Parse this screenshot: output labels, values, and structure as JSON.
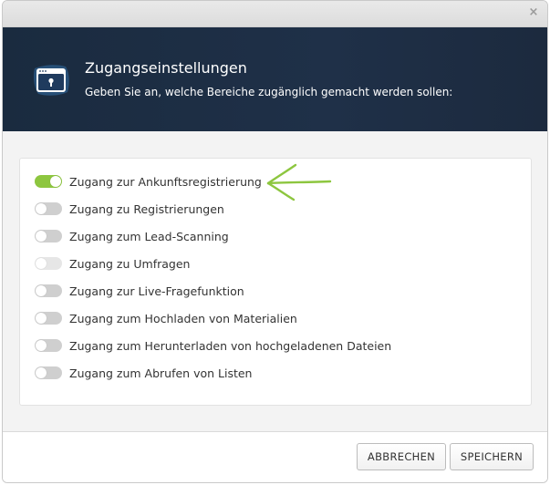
{
  "dialog": {
    "close_glyph": "×"
  },
  "header": {
    "icon": "browser-lock-icon",
    "title": "Zugangseinstellungen",
    "subtitle": "Geben Sie an, welche Bereiche zugänglich gemacht werden sollen:"
  },
  "settings": {
    "items": [
      {
        "label": "Zugang zur Ankunftsregistrierung",
        "state": "on"
      },
      {
        "label": "Zugang zu Registrierungen",
        "state": "off"
      },
      {
        "label": "Zugang zum Lead-Scanning",
        "state": "off"
      },
      {
        "label": "Zugang zu Umfragen",
        "state": "disabled"
      },
      {
        "label": "Zugang zur Live-Fragefunktion",
        "state": "off"
      },
      {
        "label": "Zugang zum Hochladen von Materialien",
        "state": "off"
      },
      {
        "label": "Zugang zum Herunterladen von hochgeladenen Dateien",
        "state": "off"
      },
      {
        "label": "Zugang zum Abrufen von Listen",
        "state": "off"
      }
    ]
  },
  "annotation": {
    "icon": "hand-drawn-arrow-icon",
    "color": "#8dc63f"
  },
  "footer": {
    "cancel_label": "ABBRECHEN",
    "save_label": "SPEICHERN"
  },
  "colors": {
    "header_bg": "#1d2d43",
    "toggle_on": "#8dc63f",
    "toggle_off": "#cfcfcf",
    "toggle_disabled": "#e6e6e6"
  }
}
